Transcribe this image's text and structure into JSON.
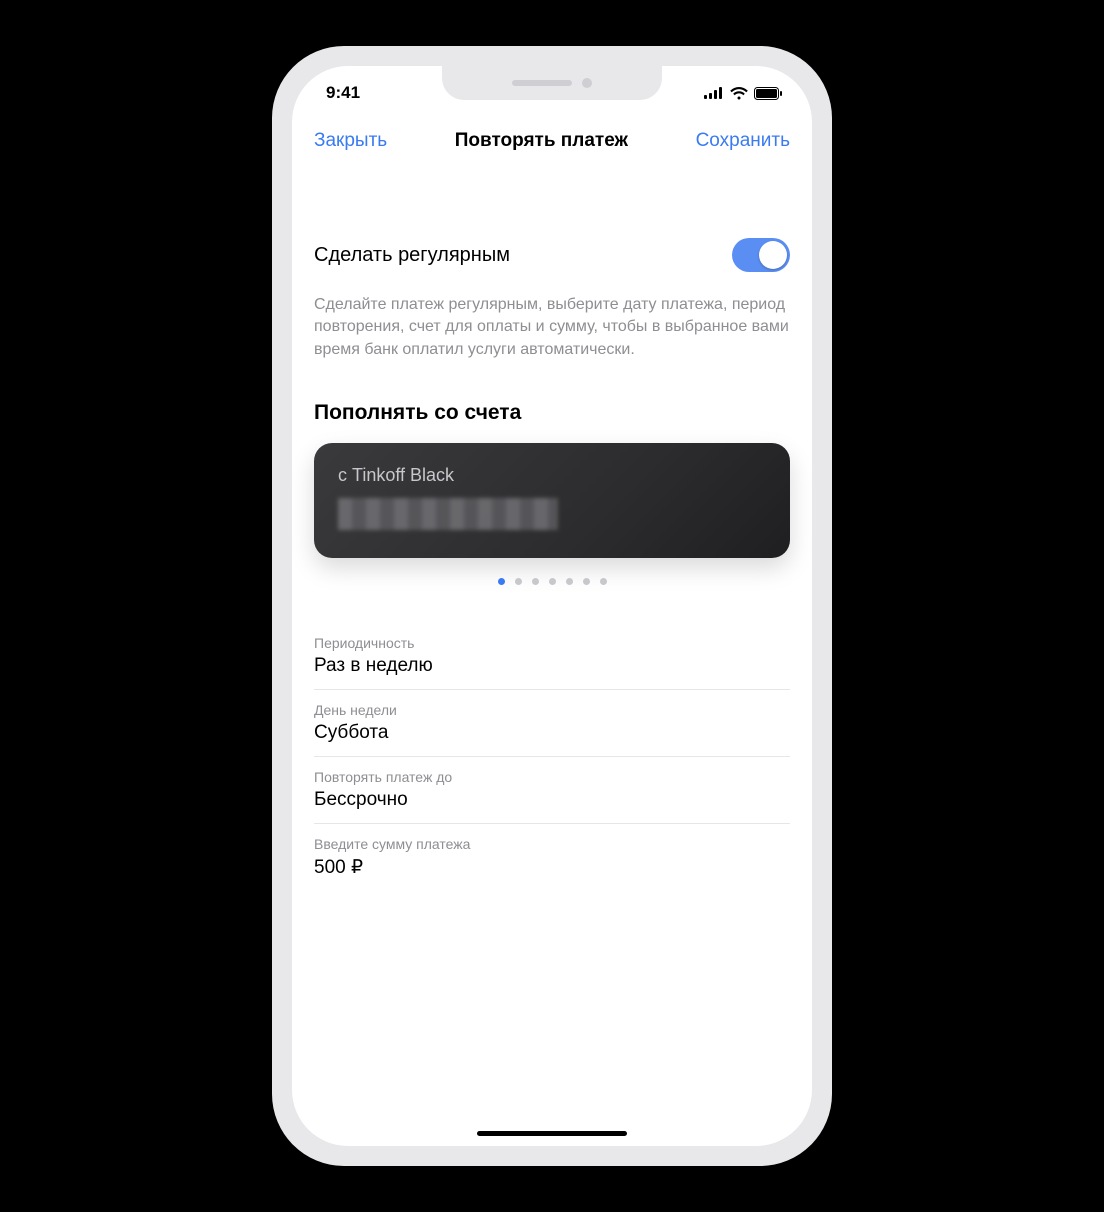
{
  "status": {
    "time": "9:41"
  },
  "nav": {
    "close": "Закрыть",
    "title": "Повторять платеж",
    "save": "Сохранить"
  },
  "toggle": {
    "label": "Сделать регулярным",
    "on": true
  },
  "description": "Сделайте платеж регулярным, выберите дату платежа, период повторения, счет для оплаты и сумму, чтобы в выбранное вами время банк оплатил услуги автоматически.",
  "account_section_title": "Пополнять со счета",
  "card": {
    "title": "с Tinkoff Black"
  },
  "pager": {
    "count": 7,
    "active": 0
  },
  "fields": [
    {
      "label": "Периодичность",
      "value": "Раз в неделю"
    },
    {
      "label": "День недели",
      "value": "Суббота"
    },
    {
      "label": "Повторять платеж до",
      "value": "Бессрочно"
    },
    {
      "label": "Введите сумму платежа",
      "value": "500 ₽"
    }
  ]
}
